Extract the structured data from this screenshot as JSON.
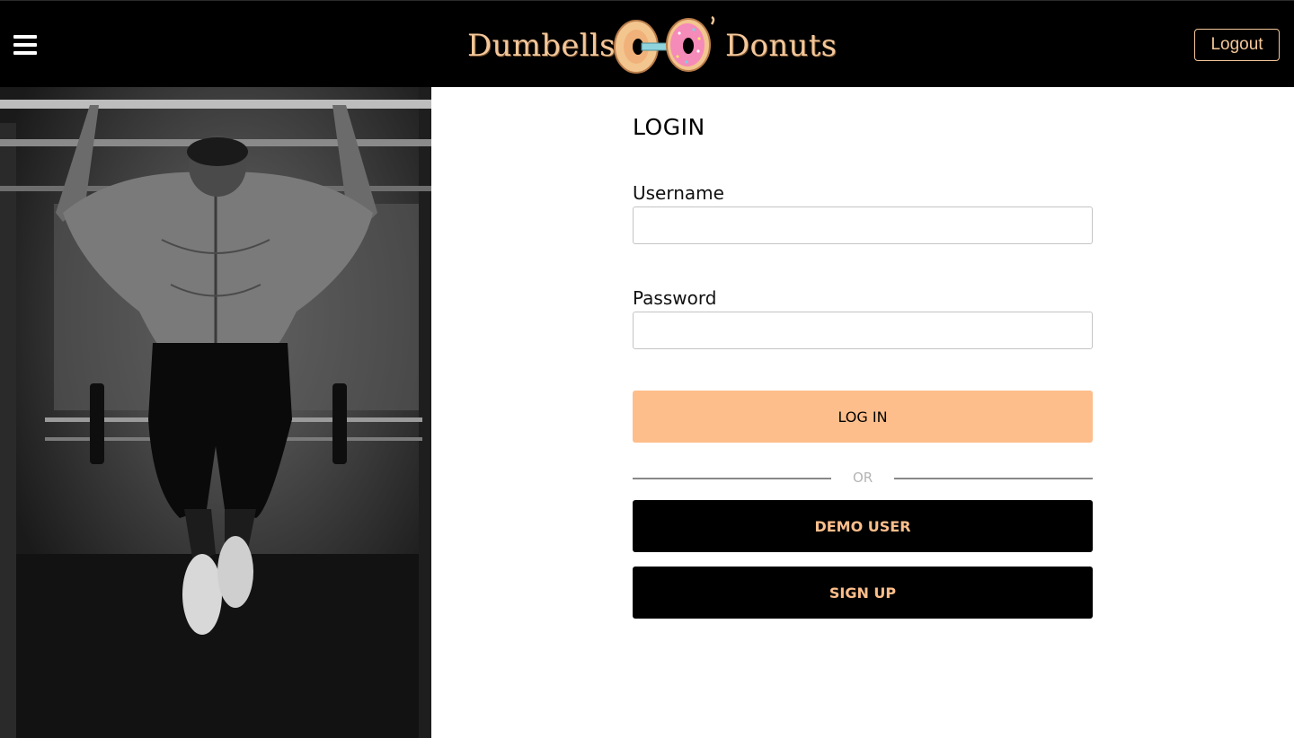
{
  "header": {
    "logo_left": "Dumbells",
    "logo_right": "Donuts",
    "logout_label": "Logout",
    "menu_icon": "hamburger-menu-icon",
    "brand_color": "#f4c79a"
  },
  "hero": {
    "image": "man-doing-pull-ups-photo"
  },
  "login": {
    "title": "LOGIN",
    "username_label": "Username",
    "username_value": "",
    "password_label": "Password",
    "password_value": "",
    "login_button": "LOG IN",
    "divider": "OR",
    "demo_button": "DEMO USER",
    "signup_button": "SIGN UP"
  },
  "colors": {
    "accent": "#fdbe8b",
    "header_bg": "#000000"
  }
}
